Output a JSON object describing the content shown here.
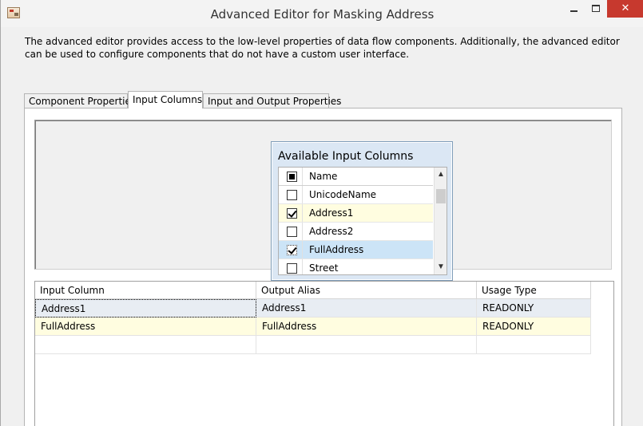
{
  "window": {
    "title": "Advanced Editor for Masking Address",
    "controls": {
      "minimize": "minimize",
      "maximize": "maximize",
      "close": "✕"
    }
  },
  "description": "The advanced editor provides access to the low-level properties of data flow components. Additionally, the advanced editor can be used to configure components that do not have a custom user interface.",
  "tabs": [
    {
      "label": "Component Properties",
      "active": false
    },
    {
      "label": "Input Columns",
      "active": true
    },
    {
      "label": "Input and Output Properties",
      "active": false
    }
  ],
  "available_columns": {
    "title": "Available Input Columns",
    "header": {
      "label": "Name",
      "state": "partial"
    },
    "items": [
      {
        "label": "UnicodeName",
        "checked": false
      },
      {
        "label": "Address1",
        "checked": true
      },
      {
        "label": "Address2",
        "checked": false
      },
      {
        "label": "FullAddress",
        "checked": true
      },
      {
        "label": "Street",
        "checked": false
      }
    ]
  },
  "grid": {
    "columns": [
      "Input Column",
      "Output Alias",
      "Usage Type"
    ],
    "rows": [
      {
        "input": "Address1",
        "alias": "Address1",
        "usage": "READONLY"
      },
      {
        "input": "FullAddress",
        "alias": "FullAddress",
        "usage": "READONLY"
      },
      {
        "input": "",
        "alias": "",
        "usage": ""
      }
    ]
  },
  "icons": {
    "app": "data-flow-component-icon",
    "scroll_up": "chevron-up-icon",
    "scroll_down": "chevron-down-icon"
  }
}
